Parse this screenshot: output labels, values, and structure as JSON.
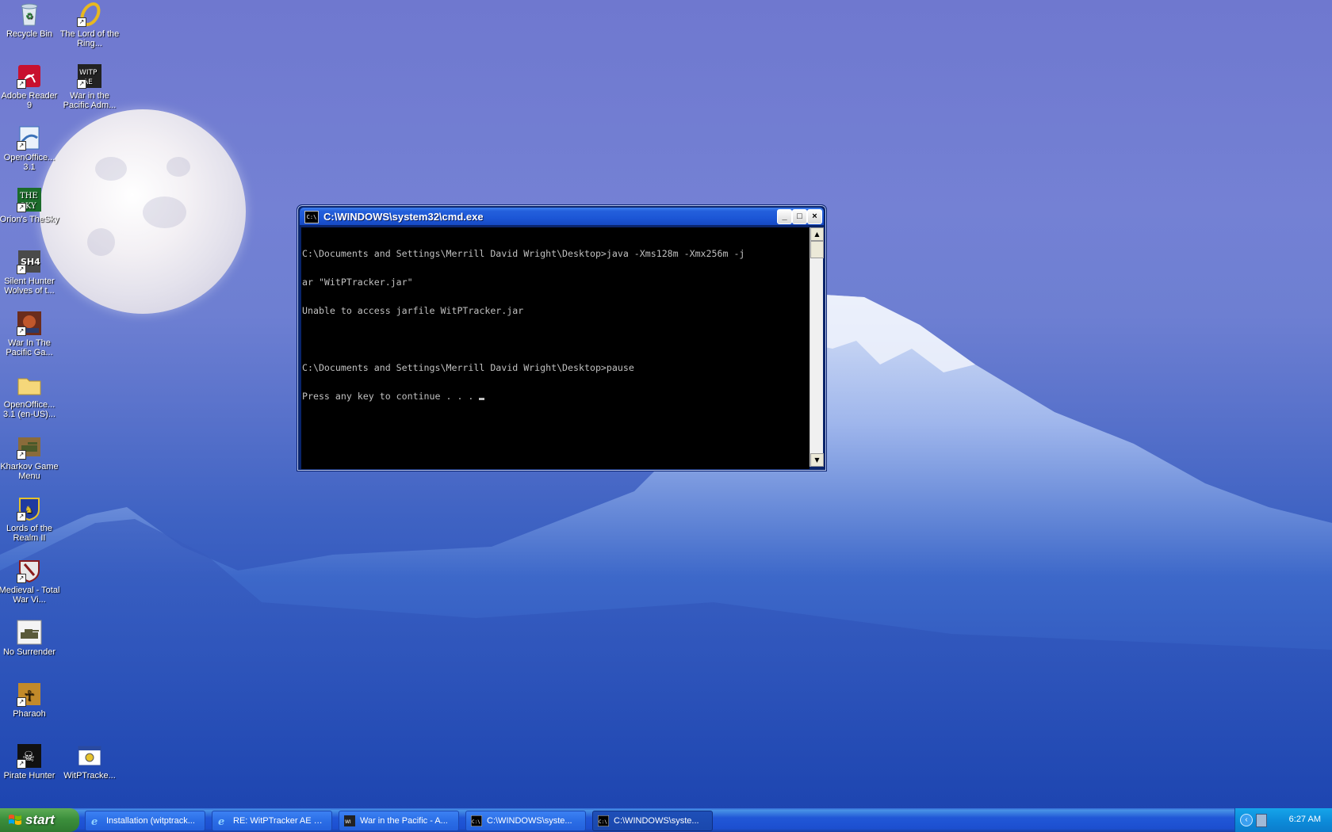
{
  "desktop": {
    "icons": [
      {
        "label": "Recycle Bin",
        "icon": "recycle-bin-icon"
      },
      {
        "label": "The Lord of the Ring...",
        "icon": "lotr-ring-icon"
      },
      {
        "label": "Adobe Reader 9",
        "icon": "adobe-reader-icon"
      },
      {
        "label": "War in the Pacific Adm...",
        "icon": "witp-ae-icon"
      },
      {
        "label": "OpenOffice... 3.1",
        "icon": "openoffice-icon"
      },
      {
        "label": "Orion's TheSky",
        "icon": "thesky-icon"
      },
      {
        "label": "Silent Hunter Wolves of t...",
        "icon": "silent-hunter-icon"
      },
      {
        "label": "War In The Pacific Ga...",
        "icon": "witp-game-icon"
      },
      {
        "label": "OpenOffice... 3.1 (en-US)...",
        "icon": "folder-icon"
      },
      {
        "label": "Kharkov Game Menu",
        "icon": "kharkov-icon"
      },
      {
        "label": "Lords of the Realm II",
        "icon": "lords-realm-icon"
      },
      {
        "label": "Medieval - Total War Vi...",
        "icon": "medieval-icon"
      },
      {
        "label": "No Surrender",
        "icon": "no-surrender-icon"
      },
      {
        "label": "Pharaoh",
        "icon": "pharaoh-icon"
      },
      {
        "label": "Pirate Hunter",
        "icon": "pirate-hunter-icon"
      },
      {
        "label": "WitPTracke...",
        "icon": "witptracker-icon"
      }
    ]
  },
  "window": {
    "title": "C:\\WINDOWS\\system32\\cmd.exe",
    "icon": "cmd-icon",
    "buttons": {
      "minimize": "_",
      "maximize": "□",
      "close": "×"
    },
    "console_lines": [
      "C:\\Documents and Settings\\Merrill David Wright\\Desktop>java -Xms128m -Xmx256m -j",
      "ar \"WitPTracker.jar\"",
      "Unable to access jarfile WitPTracker.jar",
      "",
      "C:\\Documents and Settings\\Merrill David Wright\\Desktop>pause",
      "Press any key to continue . . . "
    ]
  },
  "taskbar": {
    "start_label": "start",
    "tasks": [
      {
        "label": "Installation (witptrack...",
        "icon": "ie-icon"
      },
      {
        "label": "RE: WitPTracker AE R...",
        "icon": "ie-icon"
      },
      {
        "label": "War in the Pacific - A...",
        "icon": "witp-ae-icon"
      },
      {
        "label": "C:\\WINDOWS\\syste...",
        "icon": "cmd-icon"
      },
      {
        "label": "C:\\WINDOWS\\syste...",
        "icon": "cmd-icon"
      }
    ],
    "clock": "6:27 AM"
  },
  "colors": {
    "titlebar": "#245fdc",
    "taskbar": "#245edb",
    "start": "#3c8f3c",
    "console_bg": "#000000",
    "console_text": "#c0c0c0"
  }
}
